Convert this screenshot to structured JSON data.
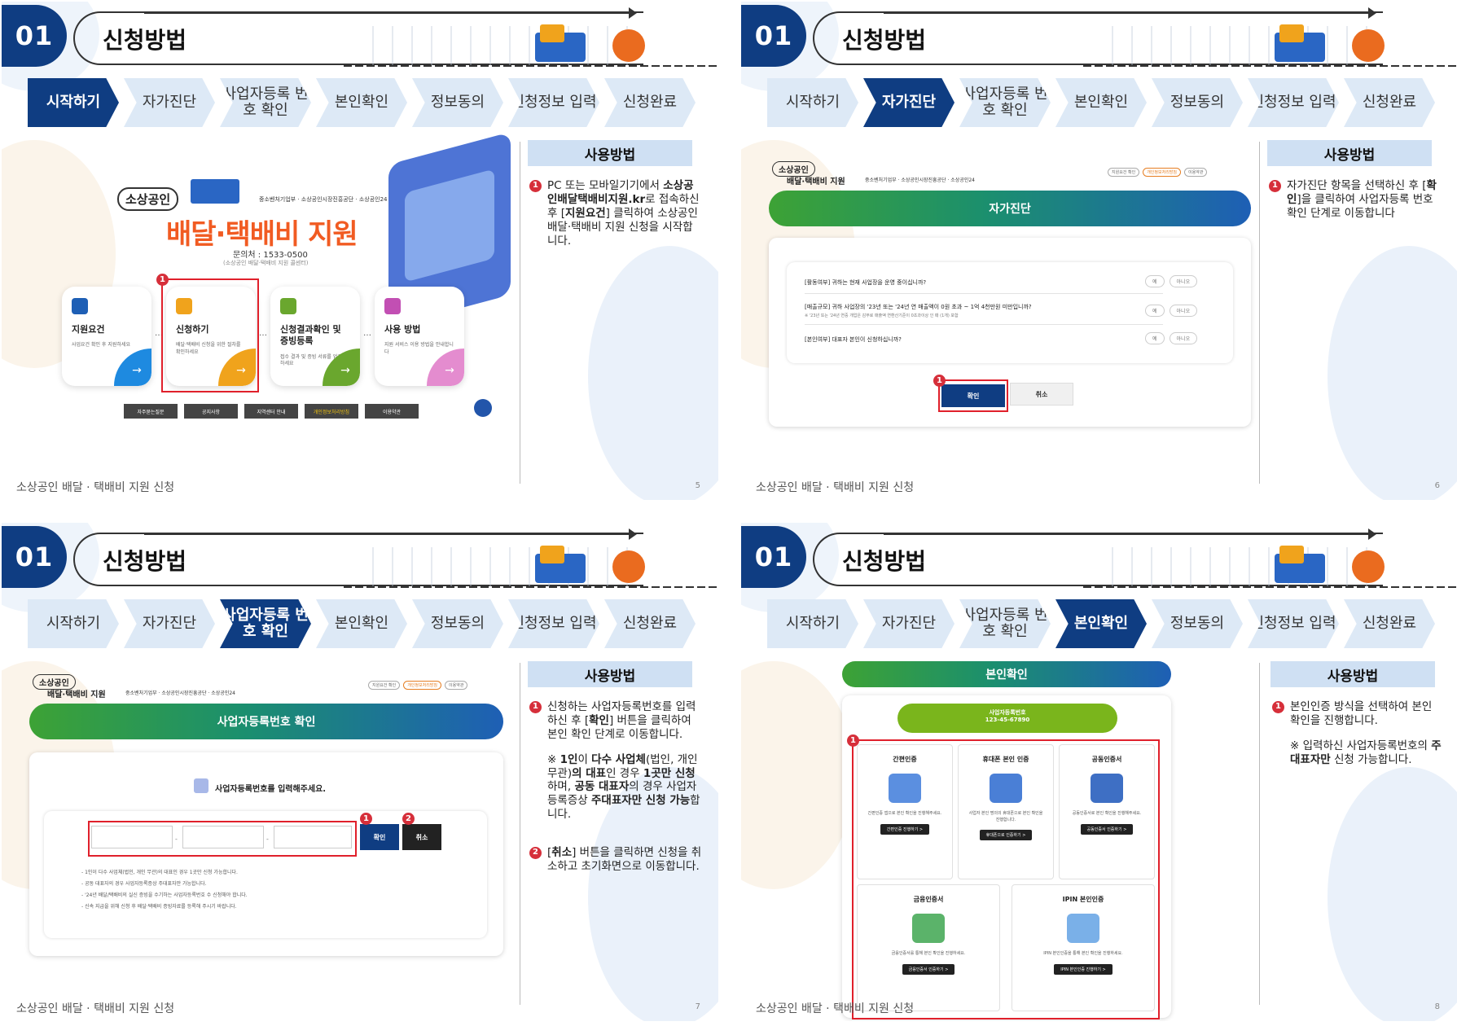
{
  "common": {
    "section_num": "01",
    "section_title": "신청방법",
    "footer": "소상공인 배달 · 택배비 지원 신청",
    "sidebar_head": "사용방법",
    "steps": [
      "시작하기",
      "자가진단",
      "사업자등록 번호 확인",
      "본인확인",
      "정보동의",
      "신청정보 입력",
      "신청완료"
    ]
  },
  "slide1": {
    "page": "5",
    "hero_badge": "소상공인",
    "hero_orgs": "중소벤처기업부 · 소상공인시장진흥공단 · 소상공인24",
    "hero_title": "배달·택배비 지원",
    "contact": "문의처 : 1533-0500",
    "contact_sub": "(소상공인 배달·택배비 지원 콜센터)",
    "cards": [
      {
        "title": "지원요건",
        "desc": "사업요건 확인 후 지원하세요"
      },
      {
        "title": "신청하기",
        "desc": "배달·택배비 신청을 위한 절차를 확인하세요"
      },
      {
        "title": "신청결과확인 및 증빙등록",
        "desc": "접수 결과 및 증빙 서류를 업로드하세요"
      },
      {
        "title": "사용 방법",
        "desc": "지원 서비스 이용 방법을 안내합니다"
      }
    ],
    "buttons": [
      "자주묻는질문",
      "공지사항",
      "지역센터 안내",
      "개인정보처리방침",
      "이용약관"
    ],
    "marker": "1",
    "text": {
      "p1_a": "PC 또는 모바일기기에서 ",
      "p1_b": "소상공인배달택배비지원.kr",
      "p1_c": "로 접속하신 후 [",
      "p1_d": "지원요건",
      "p1_e": "] 클릭하여 소상공인 배달·택배비 지원 신청을 시작합니다."
    }
  },
  "slide2": {
    "page": "6",
    "logo": "소상공인",
    "sub": "배달·택배비 지원",
    "orgs": "중소벤처기업부 · 소상공인시장진흥공단 · 소상공인24",
    "top_links": [
      "지원요건 확인",
      "개인정보처리방침",
      "이용약관"
    ],
    "banner": "자가진단",
    "questions": [
      {
        "q": "[활동여부] 귀하는 현재 사업장을 운영 중이십니까?",
        "note": ""
      },
      {
        "q": "[매출규모] 귀하 사업장의 '23년 또는 '24년 연 매출액이 0원 초과 ~ 1억 4천만원 미만입니까?",
        "note": "※ '23년 또는 '24년 연중 개업은 감무로 매출액 연환산기준이 0초과이상 인 때 (1개) 포함"
      },
      {
        "q": "[본인여부] 대표자 본인이 신청하십니까?",
        "note": ""
      }
    ],
    "yes": "예",
    "no": "아니오",
    "ok": "확인",
    "cancel": "취소",
    "marker": "1",
    "text": {
      "a": "자가진단 항목을 선택하신 후 [",
      "b": "확인",
      "c": "]을 클릭하여 사업자등록 번호 확인 단계로 이동합니다"
    }
  },
  "slide3": {
    "page": "7",
    "logo": "소상공인",
    "sub": "배달·택배비 지원",
    "orgs": "중소벤처기업부 · 소상공인시장진흥공단 · 소상공인24",
    "top_links": [
      "지원요건 확인",
      "개인정보처리방침",
      "이용약관"
    ],
    "banner": "사업자등록번호 확인",
    "prompt": "사업자등록번호를 입력해주세요.",
    "ok": "확인",
    "cancel": "취소",
    "sep": "-",
    "m1": "1",
    "m2": "2",
    "notes": [
      "- 1인이 다수 사업체(법인, 개인 무관)의 대표인 경우 1곳만 신청 가능합니다.",
      "- 공동 대표자의 경우 사업자등록증상 주대표자만 가능합니다.",
      "- '24년 배달/택배비의 실신 증빙을 수기하는 사업자등록번호 수 신청해야 합니다.",
      "- 신속 지급을 위해 신청 후 배달·택배비 증빙자료를 등록해 주시기 바랍니다."
    ],
    "text": {
      "p1_a": "신청하는 사업자등록번호를 입력하신 후 [",
      "p1_b": "확인",
      "p1_c": "] 버튼을 클릭하여 본인 확인 단계로 이동합니다.",
      "n_a": "※ ",
      "n_b": "1인",
      "n_c": "이 ",
      "n_d": "다수 사업체",
      "n_e": "(법인, 개인 무관)",
      "n_f": "의 대표",
      "n_g": "인 경우 ",
      "n_h": "1곳만 신청",
      "n_i": "하며, ",
      "n_j": "공동 대표자",
      "n_k": "의 경우 사업자등록증상 ",
      "n_l": "주대표자만 신청 가능",
      "n_m": "합니다.",
      "p2_a": "[",
      "p2_b": "취소",
      "p2_c": "] 버튼을 클릭하면 신청을 취소하고 초기화면으로 이동합니다."
    }
  },
  "slide4": {
    "page": "8",
    "banner": "본인확인",
    "bubble_title": "사업자등록번호",
    "bubble_num": "123-45-67890",
    "marker": "1",
    "methods": [
      {
        "title": "간편인증",
        "desc": "간편인증 앱으로 본인 확인을 진행해주세요.",
        "btn": "간편인증 진행하기 >"
      },
      {
        "title": "휴대폰 본인 인증",
        "desc": "사업자 본인 명의의 휴대폰으로 본인 확인을 진행합니다.",
        "btn": "휴대폰으로 인증하기 >"
      },
      {
        "title": "공동인증서",
        "desc": "공동인증서로 본인 확인을 진행해주세요.",
        "btn": "공동인증서 인증하기 >"
      },
      {
        "title": "금융인증서",
        "desc": "금융인증서를 통해 본인 확인을 진행하세요.",
        "btn": "금융인증서 인증하기 >"
      },
      {
        "title": "IPIN 본인인증",
        "desc": "IPIN 본인인증을 통해 본인 확인을 진행하세요.",
        "btn": "IPIN 본인인증 진행하기 >"
      }
    ],
    "text": {
      "p1": "본인인증 방식을 선택하여 본인 확인을 진행합니다.",
      "n_a": "※ 입력하신 사업자등록번호의 ",
      "n_b": "주대표자만",
      "n_c": " 신청 가능합니다."
    }
  },
  "colors": {
    "navy": "#0f3d82",
    "step_bg": "#dde9f6",
    "accent_red": "#e0202b",
    "orange": "#f15b22"
  }
}
